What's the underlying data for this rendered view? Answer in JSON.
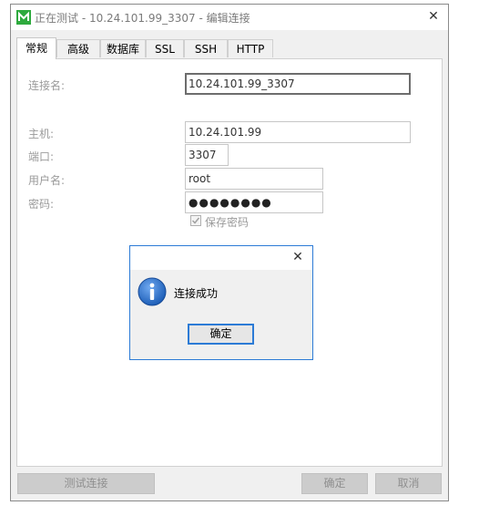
{
  "window": {
    "title": "正在测试 - 10.24.101.99_3307 - 编辑连接",
    "close_glyph": "✕"
  },
  "tabs": [
    {
      "label": "常规",
      "active": true
    },
    {
      "label": "高级",
      "active": false
    },
    {
      "label": "数据库",
      "active": false
    },
    {
      "label": "SSL",
      "active": false
    },
    {
      "label": "SSH",
      "active": false
    },
    {
      "label": "HTTP",
      "active": false
    }
  ],
  "form": {
    "connection_name_label": "连接名:",
    "connection_name_value": "10.24.101.99_3307",
    "host_label": "主机:",
    "host_value": "10.24.101.99",
    "port_label": "端口:",
    "port_value": "3307",
    "username_label": "用户名:",
    "username_value": "root",
    "password_label": "密码:",
    "password_value": "●●●●●●●●",
    "save_password_label": "保存密码",
    "save_password_checked": true
  },
  "buttons": {
    "test_connection": "测试连接",
    "ok": "确定",
    "cancel": "取消"
  },
  "dialog": {
    "message": "连接成功",
    "ok_label": "确定",
    "close_glyph": "✕",
    "icon": "info-icon"
  },
  "colors": {
    "app_icon": "#2eaa3e",
    "dialog_border": "#2c7bd6",
    "info_icon": "#1e5fb8"
  }
}
